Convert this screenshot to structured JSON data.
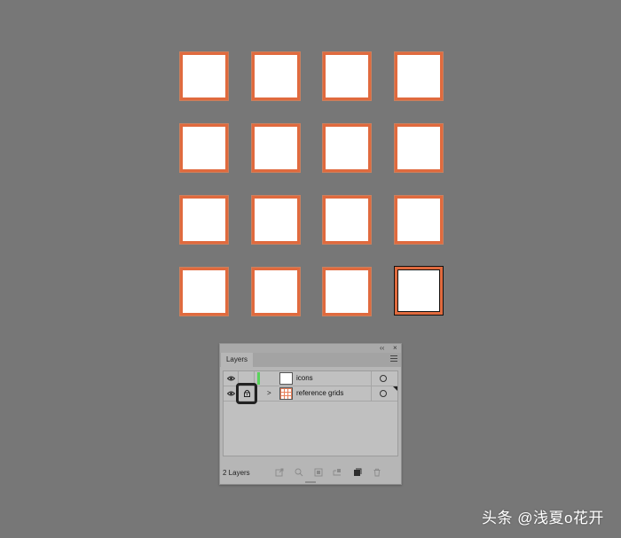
{
  "canvas": {
    "background": "#777777",
    "tile_border_color": "#e06a3e",
    "tile_fill_color": "#ffffff",
    "rows": 4,
    "columns": 4,
    "selected_tile": "row-4-col-4"
  },
  "layers_panel": {
    "collapse_label": "‹‹",
    "close_label": "×",
    "tab_label": "Layers",
    "layers": [
      {
        "name": "icons",
        "visible": true,
        "locked": false,
        "color": "#59d25b",
        "expandable": false,
        "thumbnail": "blank"
      },
      {
        "name": "reference grids",
        "visible": true,
        "locked": true,
        "color": "#e9805a",
        "expandable": true,
        "thumbnail": "grid"
      }
    ],
    "footer": {
      "layers_count": "2 Layers"
    }
  },
  "watermark": {
    "text": "头条 @浅夏o花开"
  }
}
